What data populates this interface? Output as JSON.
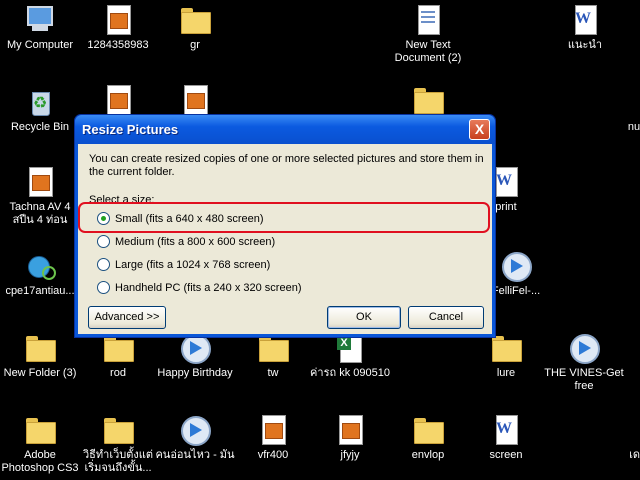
{
  "desktop_icons": [
    {
      "label": "My Computer",
      "icon": "pc-icon"
    },
    {
      "label": "1284358983",
      "icon": "image-icon"
    },
    {
      "label": "gr",
      "icon": "folder-icon"
    },
    {
      "label": "New Text Document (2)",
      "icon": "text-document-icon"
    },
    {
      "label": "แนะนำ",
      "icon": "word-document-icon"
    },
    {
      "label": "Recycle Bin",
      "icon": "recycle-bin-icon"
    },
    {
      "label": "nu",
      "icon": "folder-icon"
    },
    {
      "label": "Tachna AV 4 สปีน 4 ท่อน",
      "icon": "image-icon"
    },
    {
      "label": "print",
      "icon": "word-document-icon"
    },
    {
      "label": "cpe17antiau...",
      "icon": "network-search-icon"
    },
    {
      "label": "FelliFel-...",
      "icon": "media-icon"
    },
    {
      "label": "New Folder (3)",
      "icon": "folder-icon"
    },
    {
      "label": "rod",
      "icon": "folder-icon"
    },
    {
      "label": "Happy Birthday",
      "icon": "media-icon"
    },
    {
      "label": "tw",
      "icon": "folder-icon"
    },
    {
      "label": "ค่ารถ kk 090510",
      "icon": "excel-icon"
    },
    {
      "label": "lure",
      "icon": "folder-icon"
    },
    {
      "label": "THE VINES-Get free",
      "icon": "media-icon"
    },
    {
      "label": "Adobe Photoshop CS3",
      "icon": "folder-icon"
    },
    {
      "label": "วิธีทำเว็บตั้งแต่ เริ่มจนถึงขั้น...",
      "icon": "folder-icon"
    },
    {
      "label": "คนอ่อนไหว - มัน",
      "icon": "media-icon"
    },
    {
      "label": "vfr400",
      "icon": "image-icon"
    },
    {
      "label": "jfyjy",
      "icon": "image-icon"
    },
    {
      "label": "envlop",
      "icon": "folder-icon"
    },
    {
      "label": "screen",
      "icon": "word-document-icon"
    },
    {
      "label": "เด",
      "icon": "folder-icon"
    }
  ],
  "dialog": {
    "title": "Resize Pictures",
    "close_label": "X",
    "message": "You can create resized copies of one or more selected pictures and store them in the current folder.",
    "select_label": "Select a size:",
    "options": [
      {
        "label": "Small (fits a 640 x 480 screen)",
        "selected": true
      },
      {
        "label": "Medium (fits a 800 x 600 screen)",
        "selected": false
      },
      {
        "label": "Large (fits a 1024 x 768 screen)",
        "selected": false
      },
      {
        "label": "Handheld PC (fits a 240 x 320 screen)",
        "selected": false
      }
    ],
    "advanced_label": "Advanced >>",
    "ok_label": "OK",
    "cancel_label": "Cancel"
  },
  "colors": {
    "desktop": "#000000",
    "titlebar": "#0a57d8",
    "dialog_face": "#ece9d8",
    "highlight": "#e01020"
  }
}
